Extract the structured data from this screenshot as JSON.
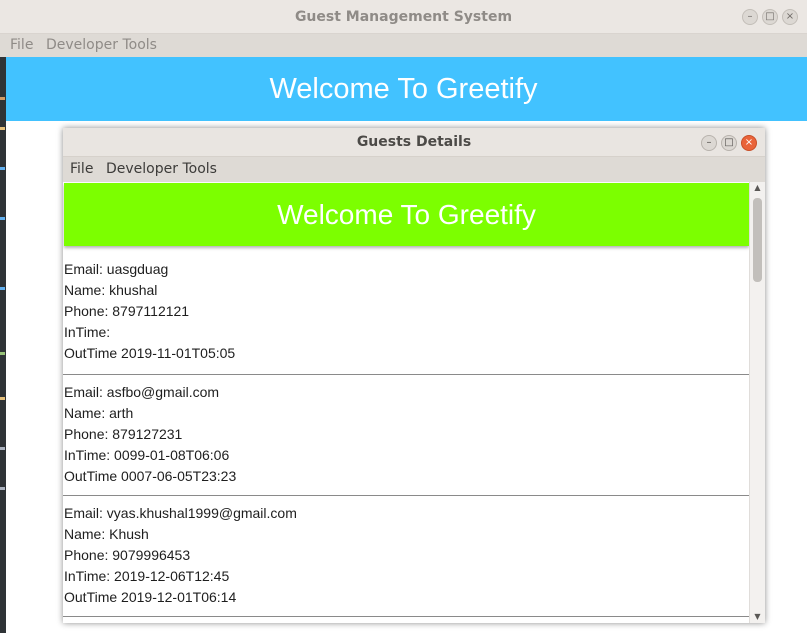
{
  "outer": {
    "title": "Guest Management System",
    "menu": [
      "File",
      "Developer Tools"
    ],
    "banner": "Welcome To Greetify",
    "banner_color": "#42c2ff"
  },
  "inner": {
    "title": "Guests Details",
    "menu": [
      "File",
      "Developer Tools"
    ],
    "banner": "Welcome To Greetify",
    "banner_color": "#7cff00",
    "guests": [
      {
        "email": "Email: uasgduag",
        "name": "Name: khushal",
        "phone": "Phone: 8797112121",
        "intime": "InTime:",
        "outtime": "OutTime 2019-11-01T05:05"
      },
      {
        "email": "Email: asfbo@gmail.com",
        "name": "Name: arth",
        "phone": "Phone: 879127231",
        "intime": "InTime: 0099-01-08T06:06",
        "outtime": "OutTime 0007-06-05T23:23"
      },
      {
        "email": "Email: vyas.khushal1999@gmail.com",
        "name": "Name: Khush",
        "phone": "Phone: 9079996453",
        "intime": "InTime: 2019-12-06T12:45",
        "outtime": "OutTime 2019-12-01T06:14"
      }
    ]
  },
  "icons": {
    "minimize": "minimize-icon",
    "maximize": "maximize-icon",
    "close": "close-icon"
  }
}
